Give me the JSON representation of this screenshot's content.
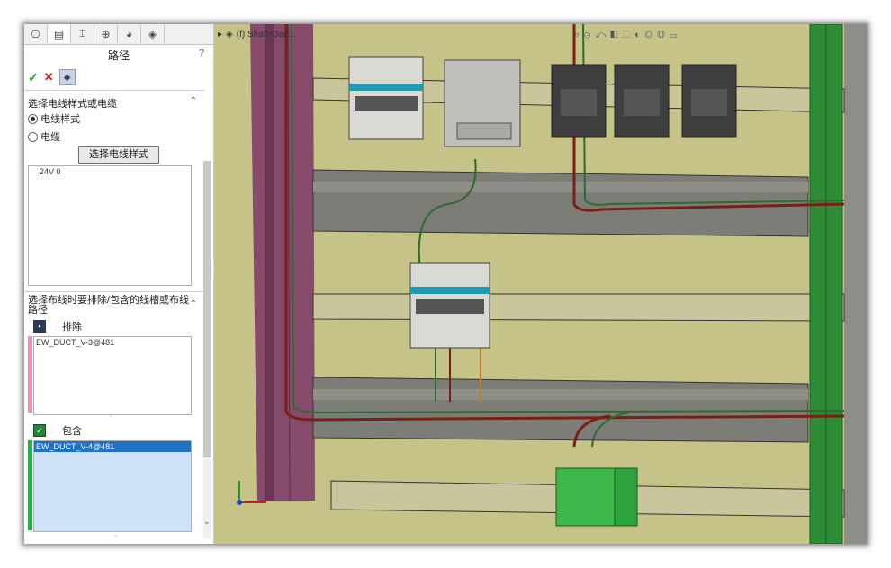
{
  "panel": {
    "tabs": [
      "feature-manager-icon",
      "property-manager-icon",
      "configuration-icon",
      "dimxpert-icon",
      "display-manager-icon",
      "appearance-icon"
    ],
    "title": "路径",
    "help": "?",
    "confirm": "✓",
    "cancel": "✕",
    "pin": "📌",
    "section1": {
      "title": "选择电线样式或电缆",
      "option1": "电线样式",
      "option2": "电缆",
      "button": "选择电线样式",
      "items": [
        "24V 0"
      ]
    },
    "section2": {
      "title_line1": "选择布线时要排除/包含的线槽或布线",
      "title_line2": "路径",
      "exclude_label": "排除",
      "exclude_items": [
        "EW_DUCT_V-3@481"
      ],
      "include_label": "包含",
      "include_items": [
        "EW_DUCT_V-4@481"
      ]
    }
  },
  "view": {
    "breadcrumb": "(f) Shaft<3ad..."
  },
  "colors": {
    "background": "#c6c388",
    "rail": "#7b7b75",
    "duct": "#8b4a6b",
    "green_duct": "#2e8b36",
    "selection": "#1e73c8"
  }
}
